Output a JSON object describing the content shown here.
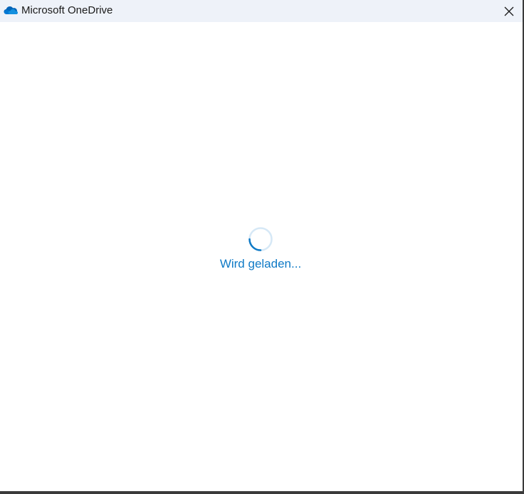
{
  "window": {
    "title": "Microsoft OneDrive",
    "app_icon": "onedrive-cloud-icon",
    "close_icon": "close-icon"
  },
  "content": {
    "loading_text": "Wird geladen...",
    "spinner_icon": "loading-spinner-icon"
  },
  "colors": {
    "titlebar_bg": "#eef2f9",
    "accent": "#0f7ac6",
    "onedrive_blue": "#0364b8"
  }
}
